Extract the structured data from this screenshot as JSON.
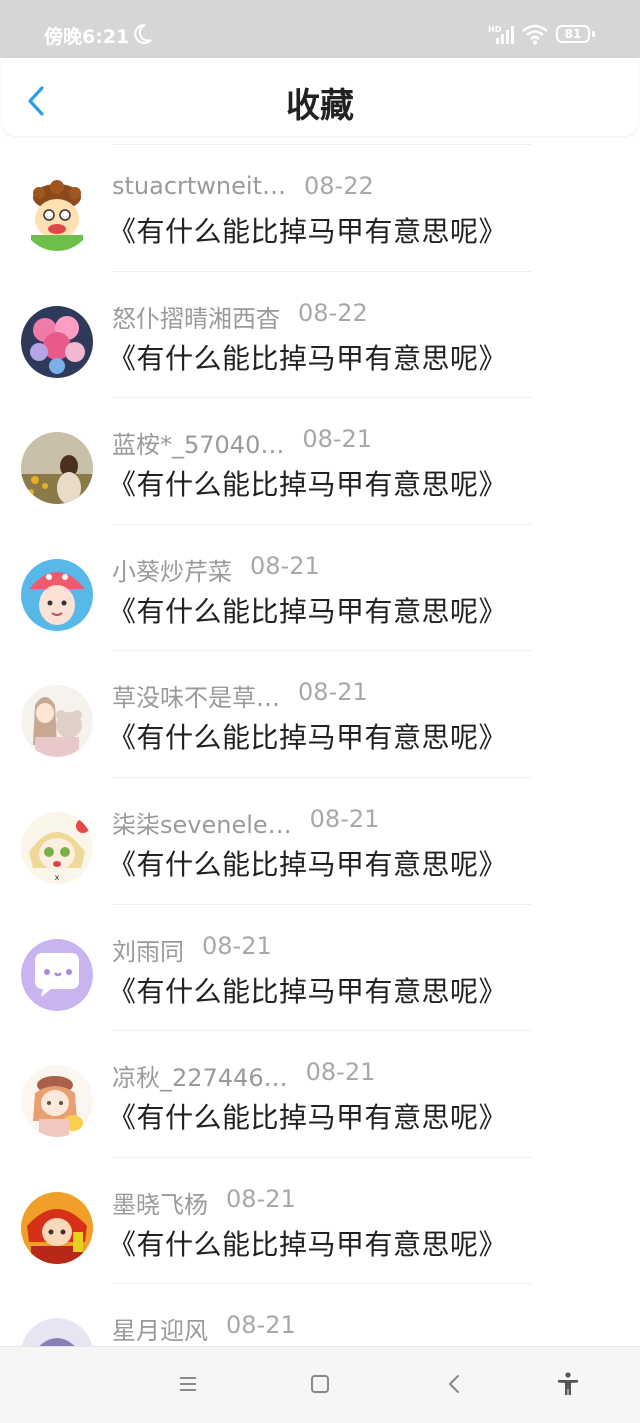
{
  "status_bar": {
    "time": "傍晚6:21",
    "battery": "81",
    "icons": [
      "moon-icon",
      "hd-signal-icon",
      "wifi-icon",
      "battery-icon"
    ]
  },
  "header": {
    "title": "收藏",
    "back_icon": "chevron-left-icon"
  },
  "colors": {
    "accent": "#2a9fe8",
    "status_bar_bg": "#d6d6d6",
    "title_text": "#222222",
    "meta_text": "#9a9a9a"
  },
  "items": [
    {
      "username": "stuacrtwneit…",
      "date": "08-22",
      "title": "《有什么能比掉马甲有意思呢》",
      "avatar": "cartoon-boy-avatar"
    },
    {
      "username": "怒仆摺晴湘西杳",
      "date": "08-22",
      "title": "《有什么能比掉马甲有意思呢》",
      "avatar": "flower-jar-avatar"
    },
    {
      "username": "蓝桉*_57040…",
      "date": "08-21",
      "title": "《有什么能比掉马甲有意思呢》",
      "avatar": "girl-field-avatar"
    },
    {
      "username": "小葵炒芹菜",
      "date": "08-21",
      "title": "《有什么能比掉马甲有意思呢》",
      "avatar": "pig-hat-avatar"
    },
    {
      "username": "草没味不是草…",
      "date": "08-21",
      "title": "《有什么能比掉马甲有意思呢》",
      "avatar": "girl-bear-avatar"
    },
    {
      "username": "柒柒sevenele…",
      "date": "08-21",
      "title": "《有什么能比掉马甲有意思呢》",
      "avatar": "anime-girl-avatar"
    },
    {
      "username": "刘雨同",
      "date": "08-21",
      "title": "《有什么能比掉马甲有意思呢》",
      "avatar": "chat-bubble-avatar"
    },
    {
      "username": "凉秋_227446…",
      "date": "08-21",
      "title": "《有什么能比掉马甲有意思呢》",
      "avatar": "girl-beret-avatar"
    },
    {
      "username": "墨晓飞杨",
      "date": "08-21",
      "title": "《有什么能比掉马甲有意思呢》",
      "avatar": "red-character-avatar"
    },
    {
      "username": "星月迎风",
      "date": "08-21",
      "title": "",
      "avatar": "purple-hair-avatar"
    }
  ],
  "nav_bar": {
    "buttons": [
      "menu-icon",
      "home-square-icon",
      "back-triangle-icon",
      "accessibility-icon"
    ]
  }
}
